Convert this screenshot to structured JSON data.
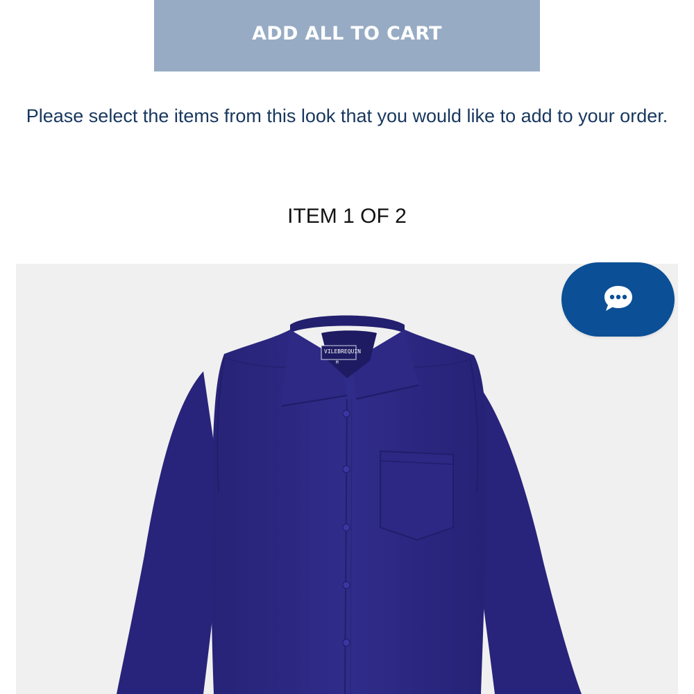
{
  "actions": {
    "add_all_label": "ADD ALL TO CART"
  },
  "instructions": {
    "text": "Please select the items from this look that you would like to add to your order."
  },
  "carousel": {
    "counter": "ITEM 1 OF 2"
  },
  "product": {
    "image_brand_tag": "VILEBREQUIN",
    "image_size_tag": "M",
    "shirt_color": "#2e2a86",
    "background_color": "#f0f0f0"
  },
  "chat": {
    "icon": "chat-bubble-icon",
    "color": "#0b4f96"
  },
  "colors": {
    "button_bg": "#97abc4",
    "text_dark_blue": "#17375e"
  }
}
